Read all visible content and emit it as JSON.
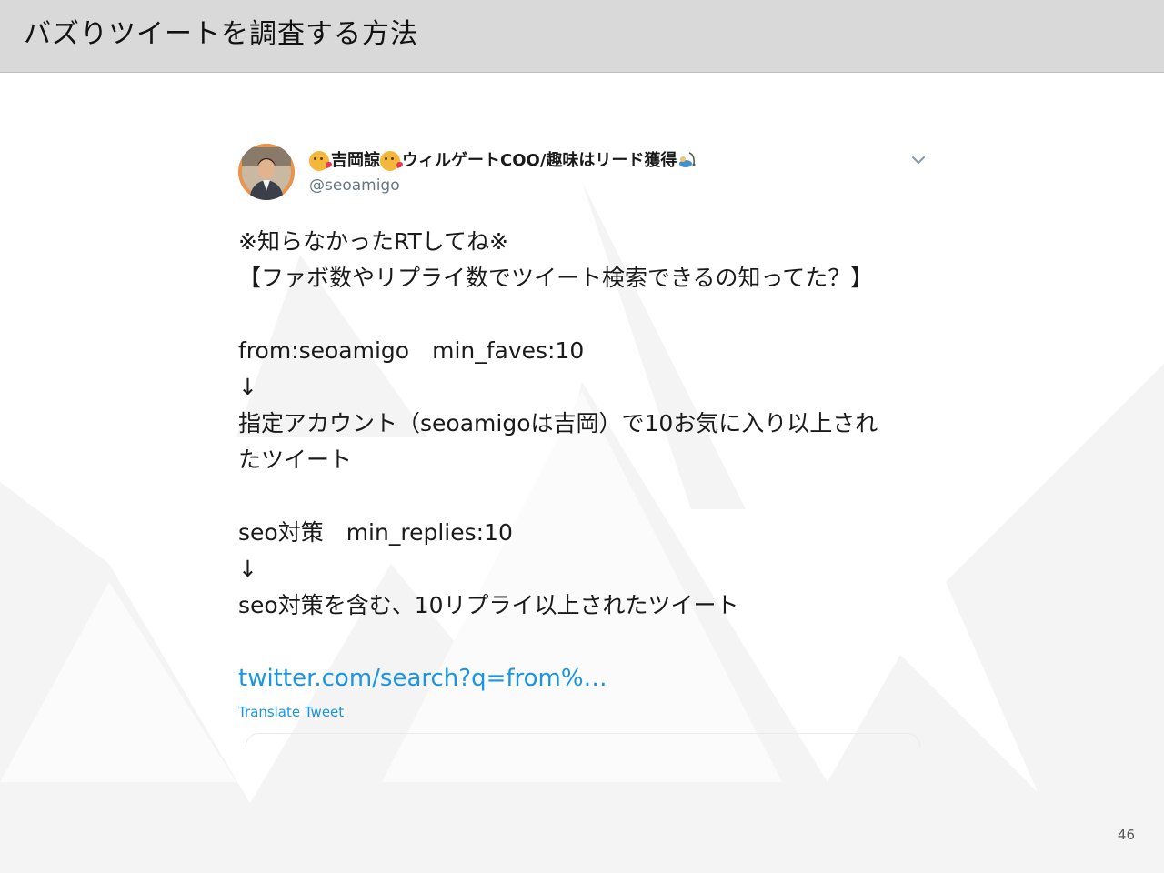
{
  "slide": {
    "title": "バズりツイートを調査する方法",
    "page_number": "46"
  },
  "tweet": {
    "display_name": {
      "emoji_1": "kissing-face-emoji",
      "part_1": "吉岡諒",
      "emoji_2": "kissing-face-emoji",
      "part_2": "ウィルゲートCOO/趣味はリード獲得",
      "emoji_3": "fishing-emoji"
    },
    "handle": "@seoamigo",
    "body": "※知らなかったRTしてね※\n【ファボ数やリプライ数でツイート検索できるの知ってた？】\n\nfrom:seoamigo　min_faves:10\n↓\n指定アカウント（seoamigoは吉岡）で10お気に入り以上され\nたツイート\n\nseo対策　min_replies:10\n↓\nseo対策を含む、10リプライ以上されたツイート",
    "link": "twitter.com/search?q=from%…",
    "translate": "Translate Tweet",
    "link_color": "#1b95e0",
    "handle_color": "#657786"
  },
  "theme": {
    "header_bg": "#d9d9d9",
    "mountain_color": "#f4f4f4"
  }
}
